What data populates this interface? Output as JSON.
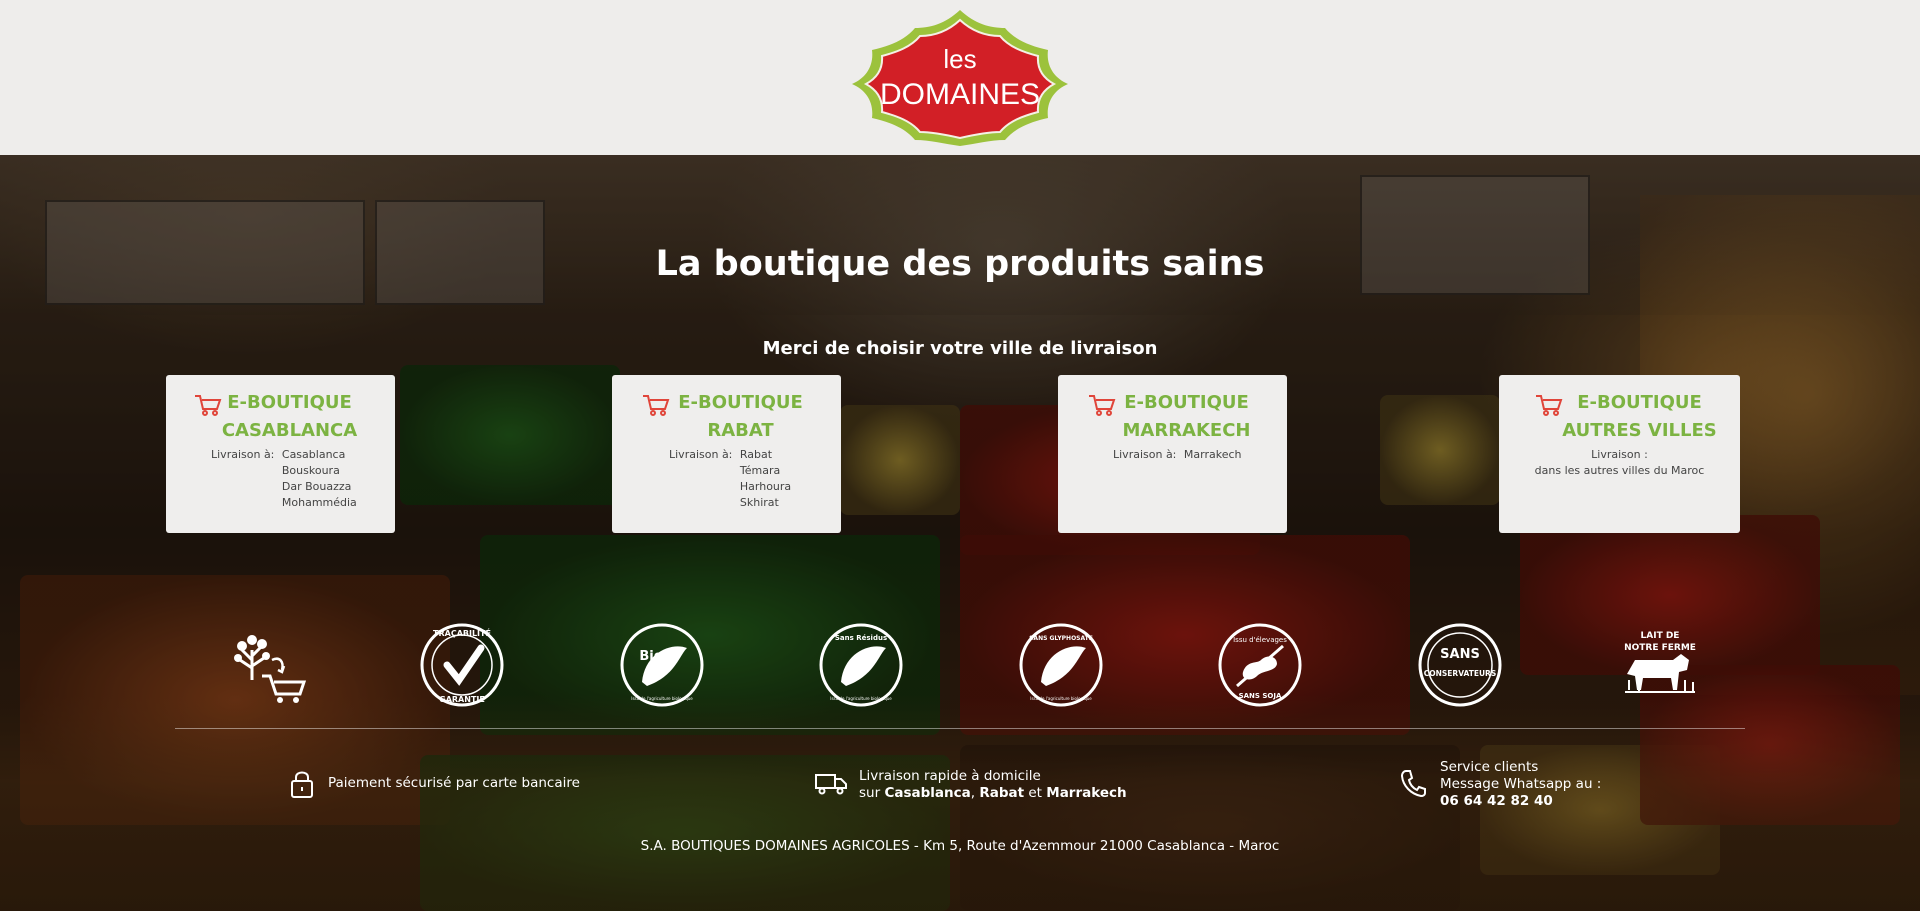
{
  "brand": {
    "logo_line1": "les",
    "logo_line2": "DOMAINES",
    "logo_red": "#d21f26",
    "logo_green": "#9cc23c"
  },
  "hero": {
    "title": "La boutique des produits sains",
    "subtitle": "Merci de choisir votre ville de livraison"
  },
  "accent_green": "#7cb342",
  "cart_red": "#e0453a",
  "cards": [
    {
      "title_line1": "E-BOUTIQUE",
      "title_line2": "CASABLANCA",
      "delivery_label": "Livraison à:",
      "cities": [
        "Casablanca",
        "Bouskoura",
        "Dar Bouazza",
        "Mohammédia"
      ]
    },
    {
      "title_line1": "E-BOUTIQUE",
      "title_line2": "RABAT",
      "delivery_label": "Livraison à:",
      "cities": [
        "Rabat",
        "Témara",
        "Harhoura",
        "Skhirat"
      ]
    },
    {
      "title_line1": "E-BOUTIQUE",
      "title_line2": "MARRAKECH",
      "delivery_label": "Livraison à:",
      "cities": [
        "Marrakech"
      ]
    },
    {
      "title_line1": "E-BOUTIQUE",
      "title_line2": "AUTRES VILLES",
      "delivery_label": "Livraison :",
      "cities": [
        "dans les autres villes du Maroc"
      ]
    }
  ],
  "badges": [
    {
      "icon": "tree-cart-icon",
      "text": ""
    },
    {
      "icon": "tracabilite-garantie-icon",
      "text_top": "TRAÇABILITÉ",
      "text_bottom": "GARANTIE"
    },
    {
      "icon": "bio-icon",
      "text_top": "Bio",
      "text_bottom": "Issu de l'agriculture biologique"
    },
    {
      "icon": "sans-residus-icon",
      "text_top": "Sans Résidus",
      "text_bottom": "Issu de l'agriculture biologique"
    },
    {
      "icon": "sans-glyphosate-icon",
      "text_top": "SANS GLYPHOSATE",
      "text_bottom": "Issu de l'agriculture biologique"
    },
    {
      "icon": "sans-soja-icon",
      "text_top": "Issu d'élevages",
      "text_bottom": "SANS SOJA"
    },
    {
      "icon": "sans-conservateurs-icon",
      "text_top": "SANS",
      "text_bottom": "CONSERVATEURS"
    },
    {
      "icon": "lait-ferme-icon",
      "text_top": "LAIT DE",
      "text_bottom": "NOTRE FERME"
    }
  ],
  "footer": {
    "payment": "Paiement sécurisé par carte bancaire",
    "delivery_line1": "Livraison rapide à domicile",
    "delivery_prefix": "sur",
    "delivery_city1": "Casablanca",
    "delivery_sep": ",",
    "delivery_city2": "Rabat",
    "delivery_and": "et",
    "delivery_city3": "Marrakech",
    "service_line1": "Service clients",
    "service_line2": "Message Whatsapp au :",
    "service_phone": "06 64 42 82 40",
    "address": "S.A. BOUTIQUES DOMAINES AGRICOLES - Km 5, Route d'Azemmour 21000 Casablanca - Maroc"
  }
}
